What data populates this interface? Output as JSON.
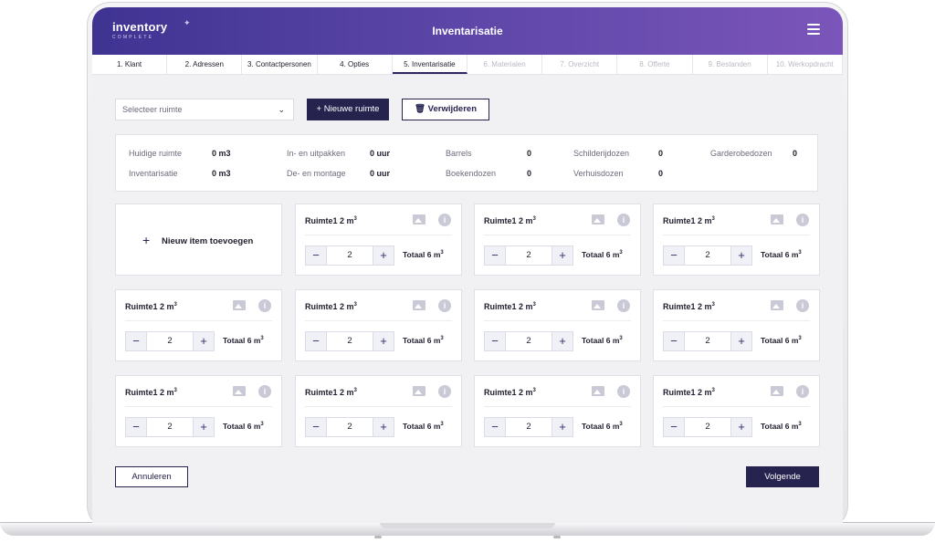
{
  "brand": {
    "name": "inventory",
    "subtitle": "COMPLETE"
  },
  "header": {
    "title": "Inventarisatie",
    "menu_icon": "hamburger-icon"
  },
  "steps": [
    {
      "label": "1. Klant",
      "state": "done"
    },
    {
      "label": "2. Adressen",
      "state": "done"
    },
    {
      "label": "3. Contactpersonen",
      "state": "done"
    },
    {
      "label": "4. Opties",
      "state": "done"
    },
    {
      "label": "5. Inventarisatie",
      "state": "active"
    },
    {
      "label": "6. Materialen",
      "state": "todo"
    },
    {
      "label": "7. Overzicht",
      "state": "todo"
    },
    {
      "label": "8. Offerte",
      "state": "todo"
    },
    {
      "label": "9. Bestanden",
      "state": "todo"
    },
    {
      "label": "10. Werkopdracht",
      "state": "todo"
    }
  ],
  "toolbar": {
    "select_placeholder": "Selecteer ruimte",
    "new_room_label": "+ Nieuwe ruimte",
    "delete_label": "Verwijderen"
  },
  "stats": {
    "current_room_label": "Huidige ruimte",
    "current_room_value": "0 m3",
    "inventory_label": "Inventarisatie",
    "inventory_value": "0 m3",
    "packing_label": "In- en uitpakken",
    "packing_value": "0 uur",
    "assembly_label": "De- en montage",
    "assembly_value": "0 uur",
    "barrels_label": "Barrels",
    "barrels_value": "0",
    "bookboxes_label": "Boekendozen",
    "bookboxes_value": "0",
    "paintboxes_label": "Schilderijdozen",
    "paintboxes_value": "0",
    "movingboxes_label": "Verhuisdozen",
    "movingboxes_value": "0",
    "wardrobeboxes_label": "Garderobedozen",
    "wardrobeboxes_value": "0"
  },
  "add_item_label": "Nieuw item toevoegen",
  "item": {
    "title": "Ruimte1 2 m",
    "title_sup": "3",
    "qty": "2",
    "total": "Totaal 6 m",
    "total_sup": "3",
    "minus": "−",
    "plus": "+"
  },
  "footer": {
    "cancel_label": "Annuleren",
    "next_label": "Volgende"
  },
  "colors": {
    "primary": "#26234f",
    "header_start": "#3f3392",
    "header_end": "#7b55ba"
  }
}
